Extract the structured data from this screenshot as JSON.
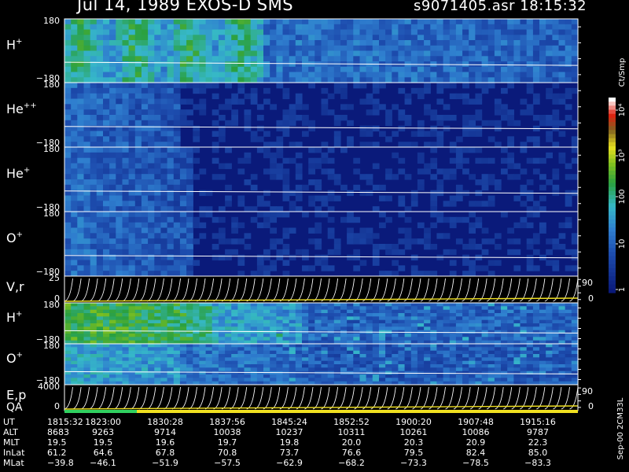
{
  "header": {
    "title": "Jul 14, 1989   EXOS-D SMS",
    "file_time": "s9071405.asr  18:15:32"
  },
  "colorbar": {
    "unit_label": "Ct/Smp",
    "tick_labels": [
      "10⁴",
      "10³",
      "100",
      "10",
      "1"
    ]
  },
  "side_label": "Sep-00 2CM33L",
  "chart_data": {
    "type": "heatmap",
    "panels": [
      {
        "species_base": "H",
        "species_sup": "+",
        "top_label": "180",
        "bottom_label": "−180",
        "mid_label": "",
        "right_label": "",
        "right_label2": ""
      },
      {
        "species_base": "He",
        "species_sup": "++",
        "top_label": "180",
        "bottom_label": "−180",
        "mid_label": "",
        "right_label": "",
        "right_label2": ""
      },
      {
        "species_base": "He",
        "species_sup": "+",
        "top_label": "180",
        "bottom_label": "−180",
        "mid_label": "",
        "right_label": "",
        "right_label2": ""
      },
      {
        "species_base": "O",
        "species_sup": "+",
        "top_label": "180",
        "bottom_label": "−180",
        "mid_label": "",
        "right_label": "",
        "right_label2": ""
      },
      {
        "species_base": "V,r",
        "species_sup": "",
        "top_label": "25",
        "bottom_label": "0",
        "mid_label": "",
        "right_label": "90",
        "right_label2": "0"
      },
      {
        "species_base": "H",
        "species_sup": "+",
        "top_label": "180",
        "bottom_label": "−180",
        "mid_label": "",
        "right_label": "",
        "right_label2": ""
      },
      {
        "species_base": "O",
        "species_sup": "+",
        "top_label": "180",
        "bottom_label": "−180",
        "mid_label": "",
        "right_label": "",
        "right_label2": ""
      },
      {
        "species_base": "E,p",
        "species_sup": "",
        "top_label": "4000",
        "bottom_label": "0",
        "mid_label": "",
        "right_label": "90",
        "right_label2": "0"
      }
    ],
    "qa_label": "QA",
    "colorscale_values": [
      1,
      10,
      100,
      1000,
      10000
    ],
    "ephemeris": {
      "row_labels": [
        "UT",
        "ALT",
        "MLT",
        "InLat",
        "MLat"
      ],
      "columns": [
        [
          "1815:32",
          "8683",
          "19.5",
          "61.2",
          "−39.8"
        ],
        [
          "1823:00",
          "9263",
          "19.5",
          "64.6",
          "−46.1"
        ],
        [
          "1830:28",
          "9714",
          "19.6",
          "67.8",
          "−51.9"
        ],
        [
          "1837:56",
          "10038",
          "19.7",
          "70.8",
          "−57.5"
        ],
        [
          "1845:24",
          "10237",
          "19.8",
          "73.7",
          "−62.9"
        ],
        [
          "1852:52",
          "10311",
          "20.0",
          "76.6",
          "−68.2"
        ],
        [
          "1900:20",
          "10261",
          "20.3",
          "79.5",
          "−73.3"
        ],
        [
          "1907:48",
          "10086",
          "20.9",
          "82.4",
          "−78.5"
        ],
        [
          "1915:16",
          "9787",
          "22.3",
          "85.0",
          "−83.3"
        ]
      ]
    }
  }
}
